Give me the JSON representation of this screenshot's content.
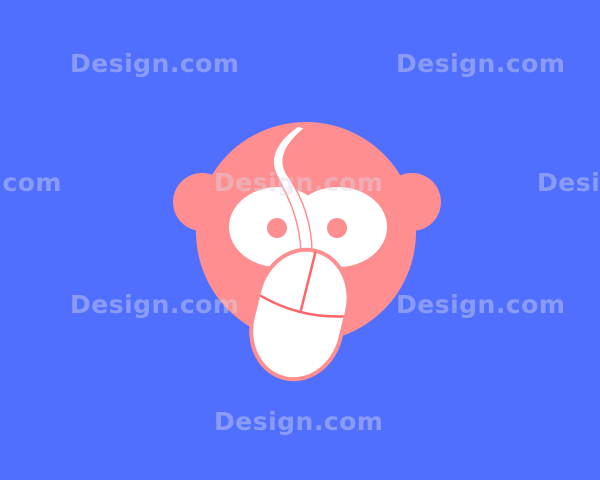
{
  "background_color": "#516ffe",
  "logo": {
    "icon": "monkey-face-with-computer-mouse-icon",
    "colors": {
      "face": "#ff8e90",
      "eye_white": "#ffffff",
      "pupil": "#ff8e90",
      "mouse_body": "#ffffff",
      "mouse_outline": "#ff6468",
      "cable": "#ffffff"
    }
  },
  "watermark": {
    "text": "Design.com",
    "color": "#d9d9e6"
  }
}
